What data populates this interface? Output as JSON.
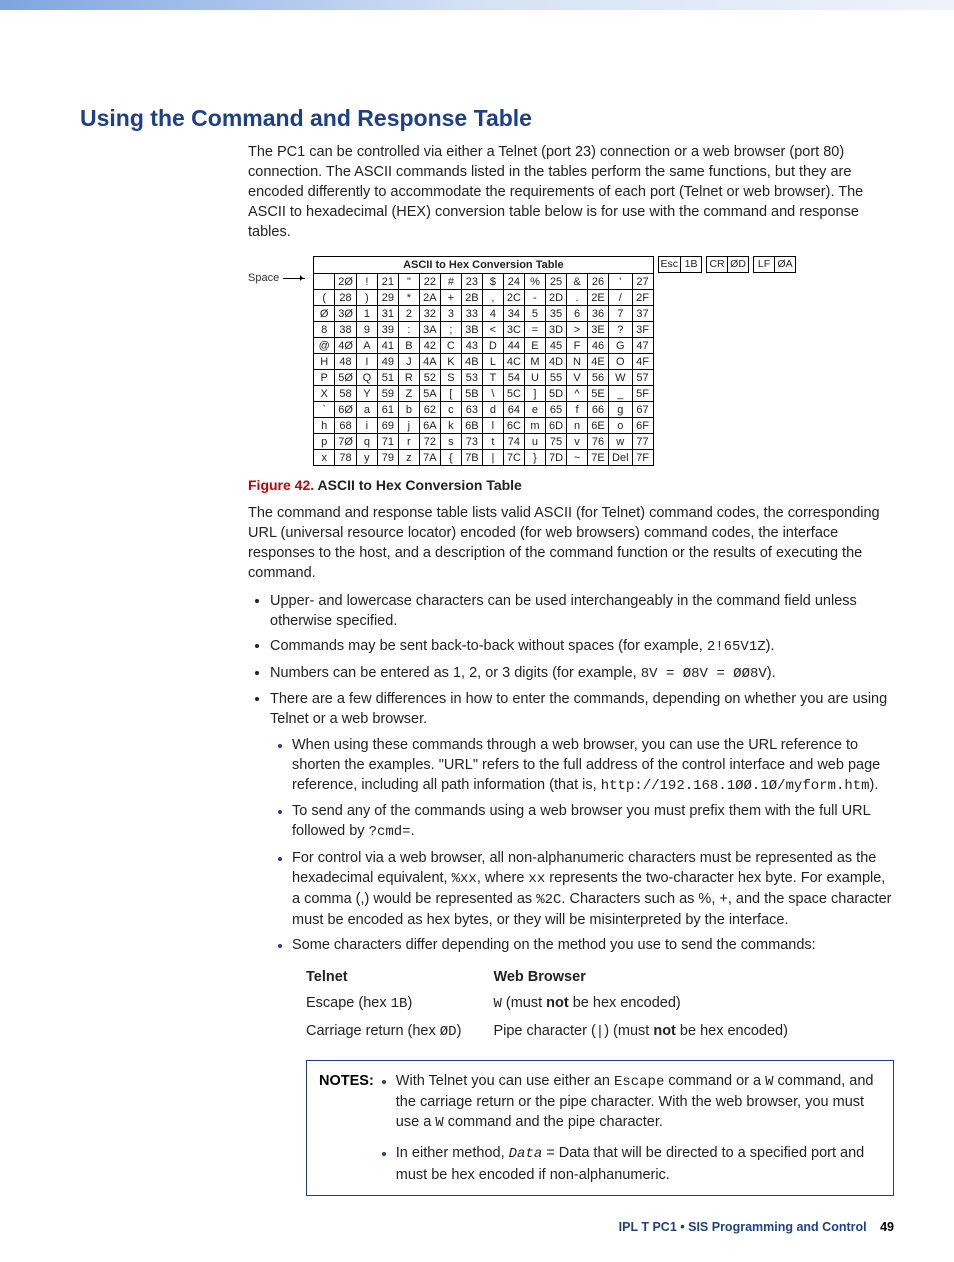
{
  "heading": "Using the Command and Response Table",
  "intro": "The PC1 can be controlled via either a Telnet (port 23) connection or a web browser (port 80) connection. The ASCII commands listed in the tables perform the same functions, but they are encoded differently to accommodate the requirements of each port (Telnet or web browser). The ASCII to hexadecimal (HEX) conversion table below is for use with the command and response tables.",
  "conv": {
    "space_label": "Space",
    "title": "ASCII to Hex Conversion Table",
    "extras": [
      {
        "k": "Esc",
        "v": "1B"
      },
      {
        "k": "CR",
        "v": "ØD"
      },
      {
        "k": "LF",
        "v": "ØA"
      }
    ],
    "rows": [
      [
        "",
        "2Ø",
        "!",
        "21",
        "\"",
        "22",
        "#",
        "23",
        "$",
        "24",
        "%",
        "25",
        "&",
        "26",
        "'",
        "27"
      ],
      [
        "(",
        "28",
        ")",
        "29",
        "*",
        "2A",
        "+",
        "2B",
        ",",
        "2C",
        "-",
        "2D",
        ".",
        "2E",
        "/",
        "2F"
      ],
      [
        "Ø",
        "3Ø",
        "1",
        "31",
        "2",
        "32",
        "3",
        "33",
        "4",
        "34",
        "5",
        "35",
        "6",
        "36",
        "7",
        "37"
      ],
      [
        "8",
        "38",
        "9",
        "39",
        ":",
        "3A",
        ";",
        "3B",
        "<",
        "3C",
        "=",
        "3D",
        ">",
        "3E",
        "?",
        "3F"
      ],
      [
        "@",
        "4Ø",
        "A",
        "41",
        "B",
        "42",
        "C",
        "43",
        "D",
        "44",
        "E",
        "45",
        "F",
        "46",
        "G",
        "47"
      ],
      [
        "H",
        "48",
        "I",
        "49",
        "J",
        "4A",
        "K",
        "4B",
        "L",
        "4C",
        "M",
        "4D",
        "N",
        "4E",
        "O",
        "4F"
      ],
      [
        "P",
        "5Ø",
        "Q",
        "51",
        "R",
        "52",
        "S",
        "53",
        "T",
        "54",
        "U",
        "55",
        "V",
        "56",
        "W",
        "57"
      ],
      [
        "X",
        "58",
        "Y",
        "59",
        "Z",
        "5A",
        "[",
        "5B",
        "\\",
        "5C",
        "]",
        "5D",
        "^",
        "5E",
        "_",
        "5F"
      ],
      [
        "`",
        "6Ø",
        "a",
        "61",
        "b",
        "62",
        "c",
        "63",
        "d",
        "64",
        "e",
        "65",
        "f",
        "66",
        "g",
        "67"
      ],
      [
        "h",
        "68",
        "i",
        "69",
        "j",
        "6A",
        "k",
        "6B",
        "l",
        "6C",
        "m",
        "6D",
        "n",
        "6E",
        "o",
        "6F"
      ],
      [
        "p",
        "7Ø",
        "q",
        "71",
        "r",
        "72",
        "s",
        "73",
        "t",
        "74",
        "u",
        "75",
        "v",
        "76",
        "w",
        "77"
      ],
      [
        "x",
        "78",
        "y",
        "79",
        "z",
        "7A",
        "{",
        "7B",
        "|",
        "7C",
        "}",
        "7D",
        "~",
        "7E",
        "Del",
        "7F"
      ]
    ]
  },
  "figcap": {
    "label": "Figure 42.",
    "title": " ASCII to Hex Conversion Table"
  },
  "para2": "The command and response table lists valid ASCII (for Telnet) command codes, the corresponding URL (universal resource locator) encoded (for web browsers) command codes, the interface responses to the host, and a description of the command function or the results of executing the command.",
  "bullets": {
    "b1": "Upper- and lowercase characters can be used interchangeably in the command field unless otherwise specified.",
    "b2a": "Commands may be sent back-to-back without spaces (for example, ",
    "b2code": "2!65V1Z",
    "b2b": ").",
    "b3a": "Numbers can be entered as 1, 2, or 3 digits (for example, ",
    "b3code": "8V = Ø8V = ØØ8V",
    "b3b": ").",
    "b4": "There are a few differences in how to enter the commands, depending on whether you are using Telnet or a web browser.",
    "sub1a": "When using these commands through a web browser, you can use the URL reference to shorten the examples. \"URL\" refers to the full address of the control interface and web page reference, including all path information (that is, ",
    "sub1code": "http://192.168.1ØØ.1Ø/myform.htm",
    "sub1b": ").",
    "sub2a": "To send any of the commands using a web browser you must prefix them with the full URL followed by ",
    "sub2code": "?cmd=",
    "sub2b": ".",
    "sub3a": "For control via a web browser, all non-alphanumeric characters must be represented as the hexadecimal equivalent, ",
    "sub3code1": "%xx",
    "sub3b": ", where ",
    "sub3code2": "xx",
    "sub3c": " represents the two-character hex byte. For example, a comma (,) would be represented as ",
    "sub3code3": "%2C",
    "sub3d": ". Characters such as %, +, and the space character must be encoded as hex bytes, or they will be misinterpreted by the interface.",
    "sub4": "Some characters differ depending on the method you use to send the commands:"
  },
  "cmp": {
    "h1": "Telnet",
    "h2": "Web Browser",
    "r1c1a": "Escape (hex ",
    "r1c1code": "1B",
    "r1c1b": ")",
    "r1c2code": "W",
    "r1c2a": " (must ",
    "r1c2not": "not",
    "r1c2b": " be hex encoded)",
    "r2c1a": "Carriage return (hex ",
    "r2c1code": "ØD",
    "r2c1b": ")",
    "r2c2a": "Pipe character (",
    "r2c2pipe": "|",
    "r2c2b": ") (must ",
    "r2c2not": "not",
    "r2c2c": " be hex encoded)"
  },
  "notes": {
    "label": "NOTES:",
    "n1a": "With Telnet you can use either an ",
    "n1code1": "Escape",
    "n1b": " command or a ",
    "n1code2": "W",
    "n1c": " command, and the carriage return or the pipe character. With the web browser, you must use a ",
    "n1code3": "W",
    "n1d": " command and the pipe character.",
    "n2a": "In either method, ",
    "n2code": "Data",
    "n2b": " = Data that will be directed to a specified port and must be hex encoded if non-alphanumeric."
  },
  "footer": {
    "a": "IPL T PC1 • SIS Programming and Control",
    "p": "49"
  }
}
